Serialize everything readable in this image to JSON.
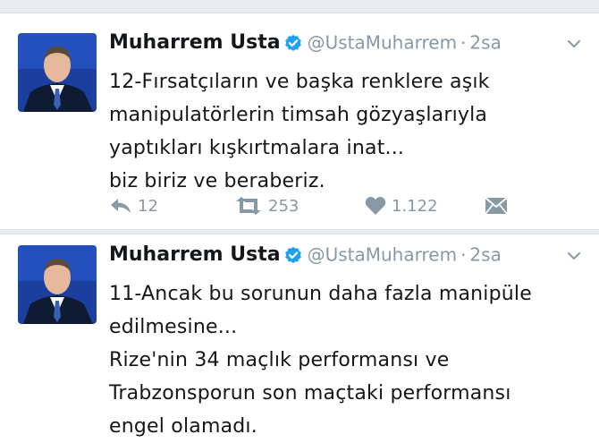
{
  "colors": {
    "accent": "#1da1f2",
    "muted": "#8899a6",
    "text": "#14171a",
    "divider": "#d8dee3",
    "gap": "#e9edf0"
  },
  "icons": {
    "verified": "verified-badge-icon",
    "caret": "chevron-down-icon",
    "reply": "reply-icon",
    "retweet": "retweet-icon",
    "like": "heart-icon",
    "dm": "envelope-icon"
  },
  "tweets": [
    {
      "author_name": "Muharrem Usta",
      "handle": "@UstaMuharrem",
      "separator": "·",
      "time": "2sa",
      "lines": [
        "12-Fırsatçıların ve başka renklere aşık",
        "manipulatörlerin timsah gözyaşlarıyla",
        "yaptıkları kışkırtmalara inat...",
        "biz biriz ve beraberiz."
      ],
      "replies": "12",
      "retweets": "253",
      "likes": "1.122"
    },
    {
      "author_name": "Muharrem Usta",
      "handle": "@UstaMuharrem",
      "separator": "·",
      "time": "2sa",
      "lines": [
        "11-Ancak bu sorunun daha fazla manipüle",
        "edilmesine...",
        "Rize'nin 34 maçlık performansı ve",
        "Trabzonsporun son maçtaki performansı",
        "engel olamadı."
      ]
    }
  ]
}
